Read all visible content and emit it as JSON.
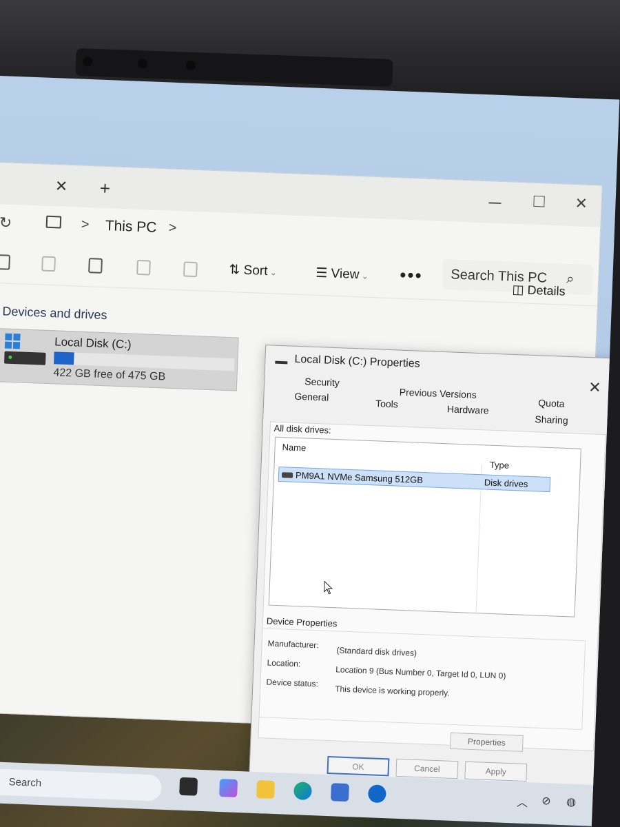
{
  "explorer": {
    "breadcrumb_sep": ">",
    "location": "This PC",
    "search_placeholder": "Search This PC",
    "toolbar": {
      "sort_label": "Sort",
      "view_label": "View",
      "more_label": "•••",
      "details_label": "Details"
    },
    "section_header": "Devices and drives",
    "drive": {
      "name": "Local Disk (C:)",
      "free_text": "422 GB free of 475 GB",
      "used_fraction": 0.11
    }
  },
  "dialog": {
    "title": "Local Disk (C:) Properties",
    "tabs": {
      "security": "Security",
      "previous_versions": "Previous Versions",
      "quota": "Quota",
      "general": "General",
      "tools": "Tools",
      "hardware": "Hardware",
      "sharing": "Sharing"
    },
    "all_disks_label": "All disk drives:",
    "columns": {
      "name": "Name",
      "type": "Type"
    },
    "disk": {
      "name": "PM9A1 NVMe Samsung 512GB",
      "type": "Disk drives"
    },
    "device_properties_label": "Device Properties",
    "properties": {
      "manufacturer_label": "Manufacturer:",
      "manufacturer_value": "(Standard disk drives)",
      "location_label": "Location:",
      "location_value": "Location 9 (Bus Number 0, Target Id 0, LUN 0)",
      "status_label": "Device status:",
      "status_value": "This device is working properly."
    },
    "properties_button": "Properties",
    "ok_button": "OK",
    "cancel_button": "Cancel",
    "apply_button": "Apply"
  },
  "taskbar": {
    "search_label": "Search"
  },
  "colors": {
    "accent": "#1f63c9",
    "selection": "#cce0f8"
  }
}
